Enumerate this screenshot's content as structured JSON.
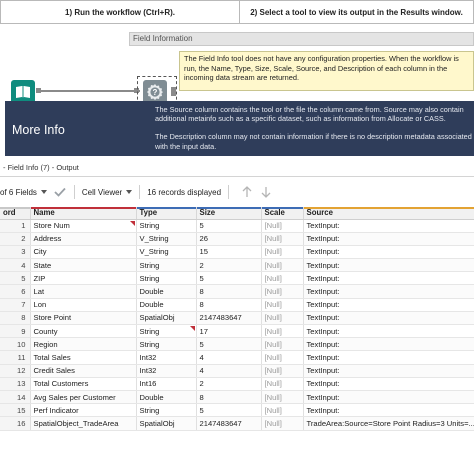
{
  "steps": {
    "step1": "1) Run the workflow (Ctrl+R).",
    "step2": "2) Select a tool to view its output in the Results window."
  },
  "tooltip": {
    "title": "Field Information",
    "body": "The Field Info tool does not have any configuration properties. When the workflow is run, the Name, Type, Size, Scale, Source, and Description of each column in the incoming data stream are returned."
  },
  "more_info": {
    "heading": "More Info",
    "para1": "The Source column contains the tool or the file the column came from. Source may also contain additional metainfo such as a specific dataset, such as information from Allocate or CASS.",
    "para2": "The Description column may not contain information if there is no description metadata associated with the input data."
  },
  "results": {
    "header": "- Field Info (7) - Output",
    "fields_label": "of 6 Fields",
    "viewer_label": "Cell Viewer",
    "record_count": "16 records displayed"
  },
  "icons": {
    "tool_input": "book-icon",
    "tool_field_info": "field-info-icon",
    "check": "check-icon",
    "up": "arrow-up-icon",
    "down": "arrow-down-icon"
  },
  "colors": {
    "more_info_bg": "#2f3d5a",
    "tooltip_bg": "#fff8cc",
    "input_tool": "#0f8c7e",
    "field_info_tool": "#7f8c93",
    "flag": "#c0303a"
  },
  "table": {
    "columns": [
      "ord",
      "Name",
      "Type",
      "Size",
      "Scale",
      "Source"
    ],
    "column_accents": [
      "#c8c8c8",
      "#c0303a",
      "#3d6cb5",
      "#3d6cb5",
      "#3d6cb5",
      "#e3a333"
    ],
    "rows": [
      {
        "rec": "1",
        "name": "Store Num",
        "type": "String",
        "size": "5",
        "scale": "[Null]",
        "source": "TextInput:"
      },
      {
        "rec": "2",
        "name": "Address",
        "type": "V_String",
        "size": "26",
        "scale": "[Null]",
        "source": "TextInput:"
      },
      {
        "rec": "3",
        "name": "City",
        "type": "V_String",
        "size": "15",
        "scale": "[Null]",
        "source": "TextInput:"
      },
      {
        "rec": "4",
        "name": "State",
        "type": "String",
        "size": "2",
        "scale": "[Null]",
        "source": "TextInput:"
      },
      {
        "rec": "5",
        "name": "ZIP",
        "type": "String",
        "size": "5",
        "scale": "[Null]",
        "source": "TextInput:"
      },
      {
        "rec": "6",
        "name": "Lat",
        "type": "Double",
        "size": "8",
        "scale": "[Null]",
        "source": "TextInput:"
      },
      {
        "rec": "7",
        "name": "Lon",
        "type": "Double",
        "size": "8",
        "scale": "[Null]",
        "source": "TextInput:"
      },
      {
        "rec": "8",
        "name": "Store Point",
        "type": "SpatialObj",
        "size": "2147483647",
        "scale": "[Null]",
        "source": "TextInput:"
      },
      {
        "rec": "9",
        "name": "County",
        "type": "String",
        "size": "17",
        "scale": "[Null]",
        "source": "TextInput:"
      },
      {
        "rec": "10",
        "name": "Region",
        "type": "String",
        "size": "5",
        "scale": "[Null]",
        "source": "TextInput:"
      },
      {
        "rec": "11",
        "name": "Total Sales",
        "type": "Int32",
        "size": "4",
        "scale": "[Null]",
        "source": "TextInput:"
      },
      {
        "rec": "12",
        "name": "Credit Sales",
        "type": "Int32",
        "size": "4",
        "scale": "[Null]",
        "source": "TextInput:"
      },
      {
        "rec": "13",
        "name": "Total Customers",
        "type": "Int16",
        "size": "2",
        "scale": "[Null]",
        "source": "TextInput:"
      },
      {
        "rec": "14",
        "name": "Avg Sales per Customer",
        "type": "Double",
        "size": "8",
        "scale": "[Null]",
        "source": "TextInput:"
      },
      {
        "rec": "15",
        "name": "Perf Indicator",
        "type": "String",
        "size": "5",
        "scale": "[Null]",
        "source": "TextInput:"
      },
      {
        "rec": "16",
        "name": "SpatialObject_TradeArea",
        "type": "SpatialObj",
        "size": "2147483647",
        "scale": "[Null]",
        "source": "TradeArea:Source=Store Point Radius=3 Units=..."
      }
    ]
  }
}
